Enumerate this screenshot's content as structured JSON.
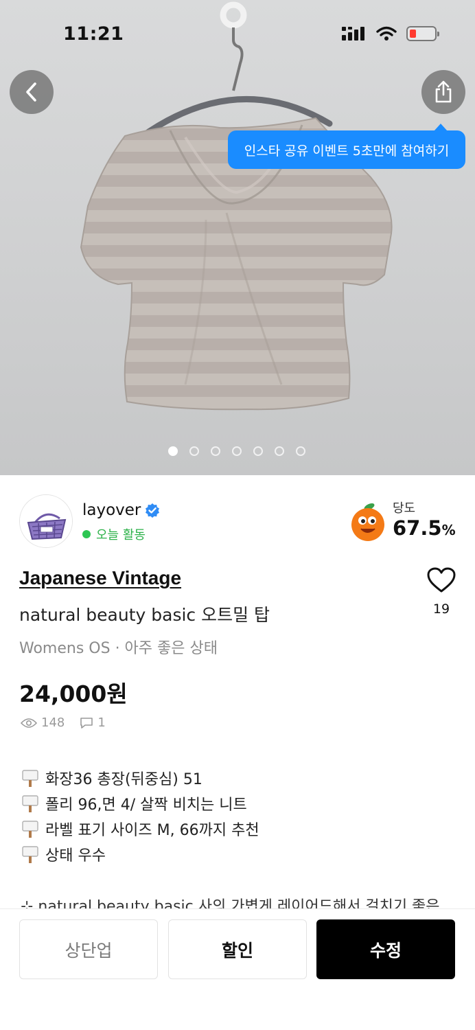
{
  "status_bar": {
    "time": "11:21"
  },
  "photo": {
    "share_tooltip": "인스타 공유 이벤트 5초만에 참여하기",
    "image_count": 7,
    "current_index": 0
  },
  "seller": {
    "name": "layover",
    "verified": true,
    "activity": "오늘 활동"
  },
  "sweetness": {
    "label": "당도",
    "value": "67.5",
    "unit": "%"
  },
  "product": {
    "brand": "Japanese Vintage",
    "title": "natural beauty basic 오트밀 탑",
    "meta": "Womens OS · 아주 좋은 상태",
    "price": "24,000원",
    "likes": "19",
    "views": "148",
    "comments": "1"
  },
  "description": {
    "lines": [
      "화장36 총장(뒤중심) 51",
      "폴리 96,면 4/ 살짝 비치는 니트",
      "라벨 표기 사이즈 M, 66까지 추천",
      "상태 우수"
    ],
    "cut_off_line": "⊹ natural beauty basic 사의 가볍게 레이어드해서 걸치기 좋은"
  },
  "actions": {
    "bump": "상단업",
    "discount": "할인",
    "edit": "수정"
  },
  "colors": {
    "accent_blue": "#1a8cff",
    "active_green": "#2dc653",
    "verified_blue": "#2f8cf5",
    "primary_black": "#000000"
  }
}
